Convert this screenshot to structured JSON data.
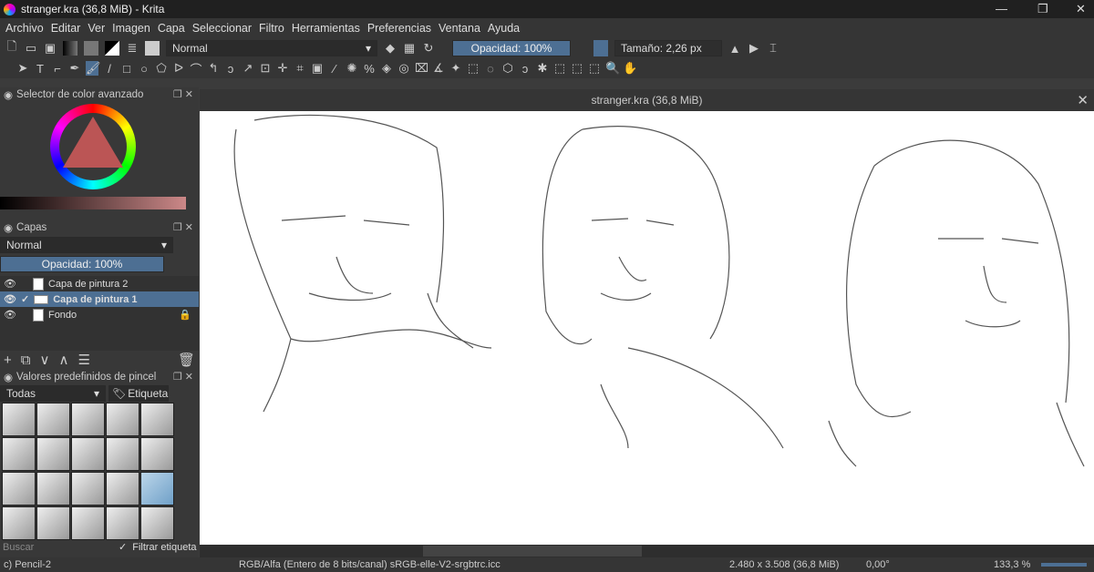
{
  "window": {
    "title": "stranger.kra (36,8 MiB)  - Krita"
  },
  "menu": [
    "Archivo",
    "Editar",
    "Ver",
    "Imagen",
    "Capa",
    "Seleccionar",
    "Filtro",
    "Herramientas",
    "Preferencias",
    "Ventana",
    "Ayuda"
  ],
  "toolbar": {
    "blend_mode": "Normal",
    "opacity": "Opacidad: 100%",
    "size": "Tamaño: 2,26 px"
  },
  "color_selector": {
    "title": "Selector de color avanzado"
  },
  "layers": {
    "title": "Capas",
    "blend_mode": "Normal",
    "opacity": "Opacidad:  100%",
    "items": [
      {
        "name": "Capa de pintura 2",
        "active": false
      },
      {
        "name": "Capa de pintura 1",
        "active": true
      },
      {
        "name": "Fondo",
        "active": false
      }
    ]
  },
  "brushes": {
    "title": "Valores predefinidos de pincel",
    "filter": "Todas",
    "tag": "Etiqueta",
    "search_placeholder": "Buscar",
    "filter_tag": "Filtrar etiqueta"
  },
  "document": {
    "tab_title": "stranger.kra (36,8 MiB)"
  },
  "status": {
    "brush": "c) Pencil-2",
    "color_space": "RGB/Alfa (Entero de 8 bits/canal)  sRGB-elle-V2-srgbtrc.icc",
    "dimensions": "2.480 x 3.508 (36,8 MiB)",
    "rotation": "0,00°",
    "zoom": "133,3 %"
  }
}
